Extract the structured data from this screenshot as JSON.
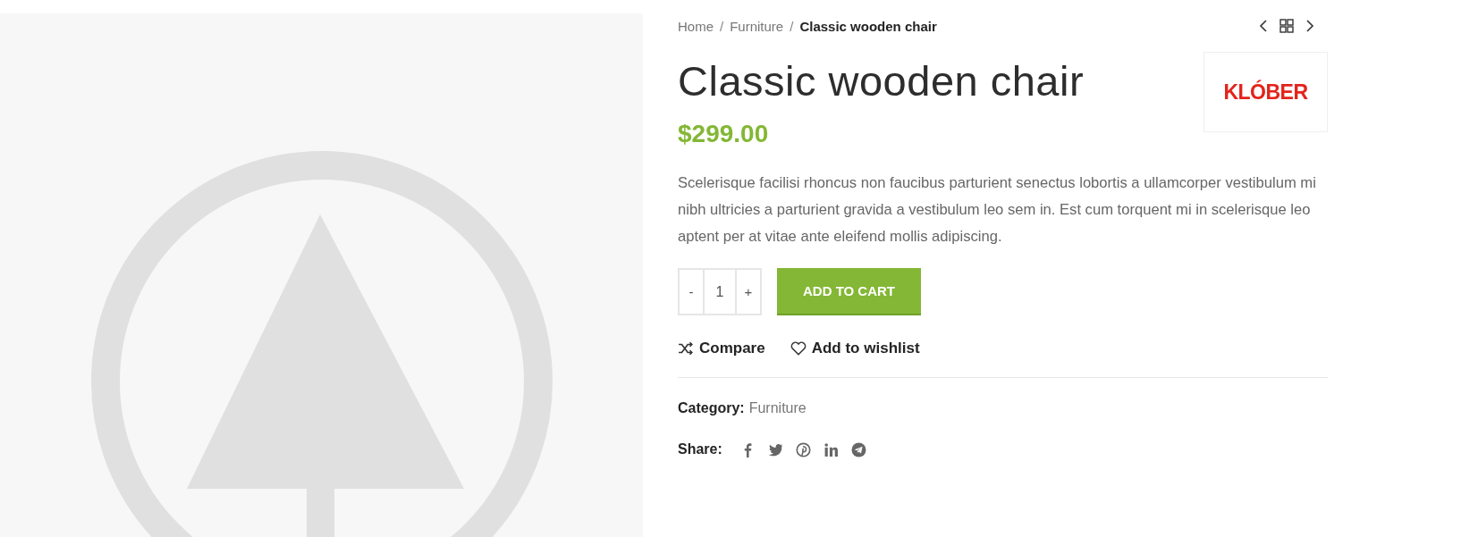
{
  "breadcrumb": [
    {
      "label": "Home",
      "current": false
    },
    {
      "separator": "/",
      "label": "Furniture",
      "current": false
    },
    {
      "separator": "/",
      "label": "Classic wooden chair",
      "current": true
    }
  ],
  "title": "Classic wooden chair",
  "brand_logo": {
    "text": "KLÓBER"
  },
  "price": "$299.00",
  "description": "Scelerisque facilisi rhoncus non faucibus parturient senectus lobortis a ullamcorper vestibulum mi nibh ultricies a parturient gravida a vestibulum leo sem in. Est cum torquent mi in scelerisque leo aptent per at vitae ante eleifend mollis adipiscing.",
  "quantity": {
    "minus": "-",
    "value": "1",
    "plus": "+"
  },
  "add_to_cart": "ADD TO CART",
  "actions": [
    {
      "kind": "compare",
      "label": "Compare"
    },
    {
      "kind": "wishlist",
      "label": "Add to wishlist"
    }
  ],
  "category": {
    "label": "Category:",
    "value": "Furniture"
  },
  "share": {
    "label": "Share:",
    "networks": [
      {
        "kind": "facebook"
      },
      {
        "kind": "twitter"
      },
      {
        "kind": "pinterest"
      },
      {
        "kind": "linkedin"
      },
      {
        "kind": "telegram"
      }
    ]
  }
}
